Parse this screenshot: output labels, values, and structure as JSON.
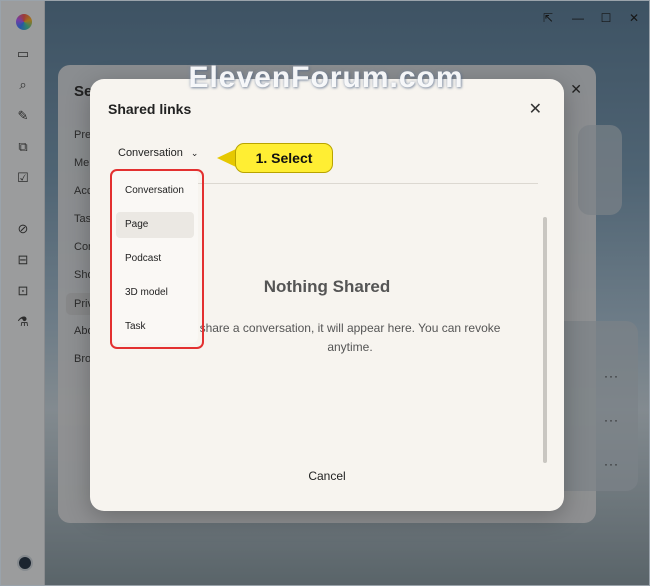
{
  "window": {
    "controls": [
      "⇱",
      "—",
      "☐",
      "✕"
    ],
    "rail_icons": [
      "sidebar-icon",
      "search-icon",
      "edit-icon",
      "copy-icon",
      "checklist-icon",
      "block-icon",
      "gift-icon",
      "image-icon",
      "flask-icon"
    ]
  },
  "settings": {
    "title": "Se",
    "nav": [
      "Pre",
      "Me",
      "Acc",
      "Tas",
      "Cor",
      "Sho",
      "Priv",
      "Abo",
      "Bro"
    ],
    "active_nav": "Priv"
  },
  "modal": {
    "title": "Shared links",
    "close": "✕",
    "selected": "Conversation",
    "empty_title": "Nothing Shared",
    "empty_desc": "share a conversation, it will appear here. You can revoke anytime.",
    "cancel": "Cancel"
  },
  "dropdown": {
    "options": [
      "Conversation",
      "Page",
      "Podcast",
      "3D model",
      "Task"
    ],
    "hovered": "Page"
  },
  "callout": {
    "text": "1. Select"
  },
  "watermark": "ElevenForum.com",
  "colors": {
    "highlight_border": "#e33030",
    "callout_fill": "#ffee33"
  }
}
